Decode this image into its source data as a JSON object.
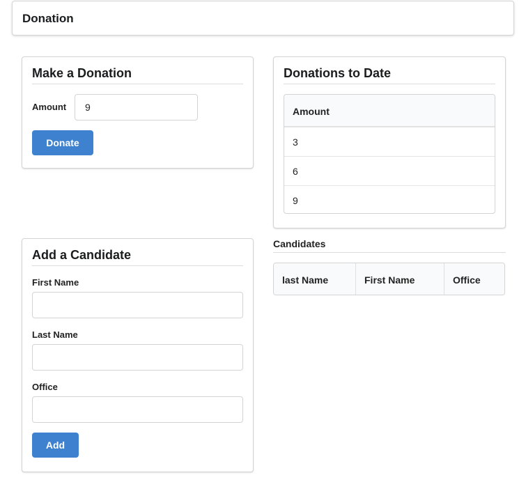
{
  "header": {
    "title": "Donation"
  },
  "make_donation": {
    "title": "Make a Donation",
    "amount_label": "Amount",
    "amount_value": "9",
    "donate_button": "Donate"
  },
  "donations_to_date": {
    "title": "Donations to Date",
    "column": "Amount",
    "rows": [
      "3",
      "6",
      "9"
    ]
  },
  "add_candidate": {
    "title": "Add a Candidate",
    "first_name_label": "First Name",
    "last_name_label": "Last Name",
    "office_label": "Office",
    "add_button": "Add"
  },
  "candidates": {
    "title": "Candidates",
    "columns": [
      "last Name",
      "First Name",
      "Office"
    ]
  },
  "colors": {
    "accent": "#3e82cf",
    "border": "#d4d4d5",
    "header_bg": "#f9fafb"
  }
}
